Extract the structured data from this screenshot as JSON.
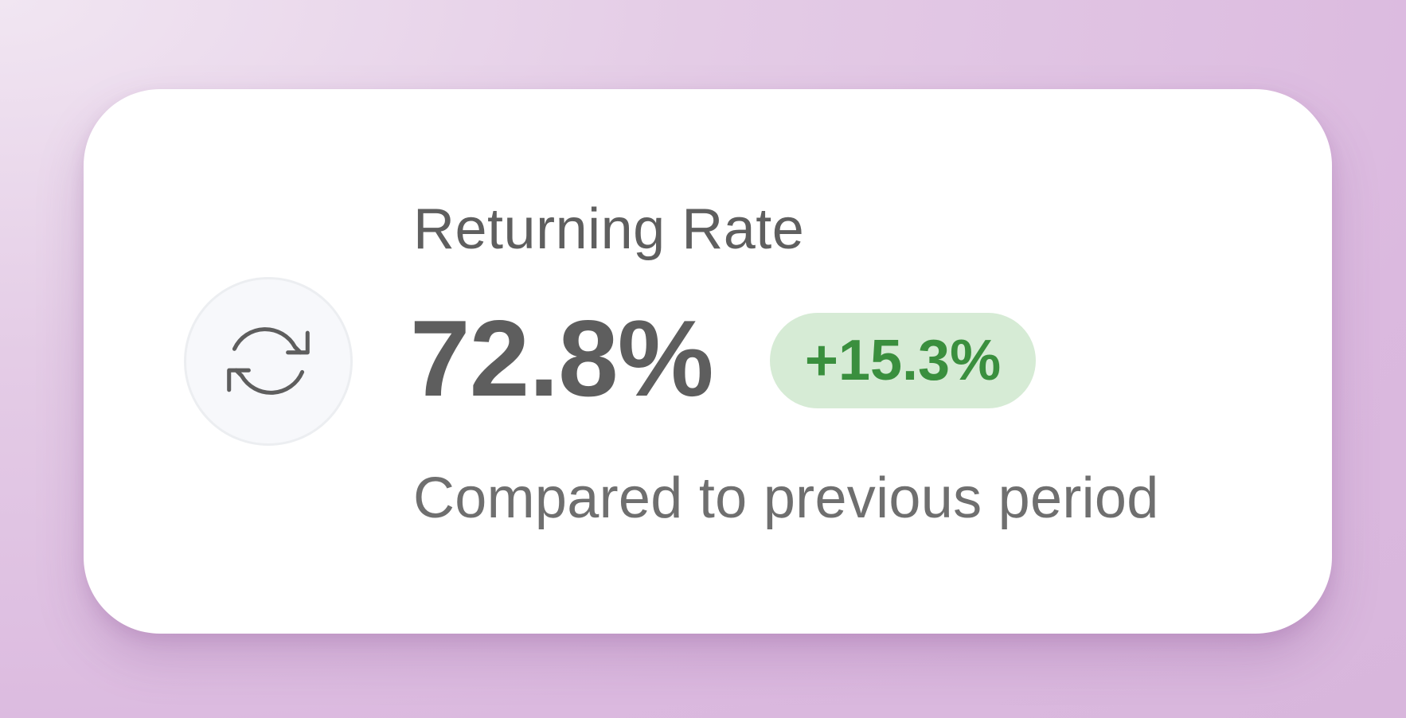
{
  "card": {
    "title": "Returning Rate",
    "value": "72.8%",
    "change": "+15.3%",
    "subtitle": "Compared to previous period",
    "icon": "refresh-icon"
  },
  "colors": {
    "background": "#dbb9df",
    "card": "#ffffff",
    "text_primary": "#5e5e5e",
    "text_secondary": "#6f6f6f",
    "badge_background": "#d6ebd5",
    "badge_text": "#3a8f3e",
    "icon_circle": "#f7f8fb"
  }
}
